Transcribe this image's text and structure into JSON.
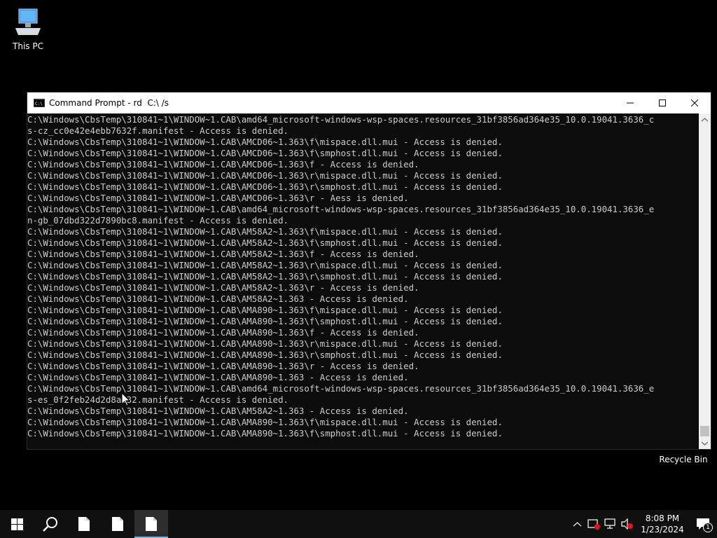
{
  "desktop": {
    "this_pc_label": "This PC",
    "recycle_bin_label": "Recycle Bin"
  },
  "window": {
    "title": "Command Prompt - rd  C:\\ /s"
  },
  "console": {
    "lines": [
      "C:\\Windows\\CbsTemp\\310841~1\\WINDOW~1.CAB\\amd64_microsoft-windows-wsp-spaces.resources_31bf3856ad364e35_10.0.19041.3636_c",
      "s-cz_cc0e42e4ebb7632f.manifest - Access is denied.",
      "C:\\Windows\\CbsTemp\\310841~1\\WINDOW~1.CAB\\AMCD06~1.363\\f\\mispace.dll.mui - Access is denied.",
      "C:\\Windows\\CbsTemp\\310841~1\\WINDOW~1.CAB\\AMCD06~1.363\\f\\smphost.dll.mui - Access is denied.",
      "C:\\Windows\\CbsTemp\\310841~1\\WINDOW~1.CAB\\AMCD06~1.363\\f - Access is denied.",
      "C:\\Windows\\CbsTemp\\310841~1\\WINDOW~1.CAB\\AMCD06~1.363\\r\\mispace.dll.mui - Access is denied.",
      "C:\\Windows\\CbsTemp\\310841~1\\WINDOW~1.CAB\\AMCD06~1.363\\r\\smphost.dll.mui - Access is denied.",
      "C:\\Windows\\CbsTemp\\310841~1\\WINDOW~1.CAB\\AMCD06~1.363\\r - Aess is denied.",
      "C:\\Windows\\CbsTemp\\310841~1\\WINDOW~1.CAB\\amd64_microsoft-windows-wsp-spaces.resources_31bf3856ad364e35_10.0.19041.3636_e",
      "n-gb_07dbd322d7890bc8.manifest - Access is denied.",
      "C:\\Windows\\CbsTemp\\310841~1\\WINDOW~1.CAB\\AM58A2~1.363\\f\\mispace.dll.mui - Access is denied.",
      "C:\\Windows\\CbsTemp\\310841~1\\WINDOW~1.CAB\\AM58A2~1.363\\f\\smphost.dll.mui - Access is denied.",
      "C:\\Windows\\CbsTemp\\310841~1\\WINDOW~1.CAB\\AM58A2~1.363\\f - Access is denied.",
      "C:\\Windows\\CbsTemp\\310841~1\\WINDOW~1.CAB\\AM58A2~1.363\\r\\mispace.dll.mui - Access is denied.",
      "C:\\Windows\\CbsTemp\\310841~1\\WINDOW~1.CAB\\AM58A2~1.363\\r\\smphost.dll.mui - Access is denied.",
      "C:\\Windows\\CbsTemp\\310841~1\\WINDOW~1.CAB\\AM58A2~1.363\\r - Access is denied.",
      "C:\\Windows\\CbsTemp\\310841~1\\WINDOW~1.CAB\\AM58A2~1.363 - Access is denied.",
      "C:\\Windows\\CbsTemp\\310841~1\\WINDOW~1.CAB\\AMA890~1.363\\f\\mispace.dll.mui - Access is denied.",
      "C:\\Windows\\CbsTemp\\310841~1\\WINDOW~1.CAB\\AMA890~1.363\\f\\smphost.dll.mui - Access is denied.",
      "C:\\Windows\\CbsTemp\\310841~1\\WINDOW~1.CAB\\AMA890~1.363\\f - Access is denied.",
      "C:\\Windows\\CbsTemp\\310841~1\\WINDOW~1.CAB\\AMA890~1.363\\r\\mispace.dll.mui - Access is denied.",
      "C:\\Windows\\CbsTemp\\310841~1\\WINDOW~1.CAB\\AMA890~1.363\\r\\smphost.dll.mui - Access is denied.",
      "C:\\Windows\\CbsTemp\\310841~1\\WINDOW~1.CAB\\AMA890~1.363\\r - Access is denied.",
      "C:\\Windows\\CbsTemp\\310841~1\\WINDOW~1.CAB\\AMA890~1.363 - Access is denied.",
      "C:\\Windows\\CbsTemp\\310841~1\\WINDOW~1.CAB\\amd64_microsoft-windows-wsp-spaces.resources_31bf3856ad364e35_10.0.19041.3636_e",
      "s-es_0f2feb24d2d8a132.manifest - Access is denied.",
      "C:\\Windows\\CbsTemp\\310841~1\\WINDOW~1.CAB\\AM58A2~1.363 - Access is denied.",
      "C:\\Windows\\CbsTemp\\310841~1\\WINDOW~1.CAB\\AMA890~1.363\\f\\mispace.dll.mui - Access is denied.",
      "C:\\Windows\\CbsTemp\\310841~1\\WINDOW~1.CAB\\AMA890~1.363\\f\\smphost.dll.mui - Access is denied."
    ]
  },
  "taskbar": {
    "time": "8:08 PM",
    "date": "1/23/2024",
    "notification_count": "1"
  },
  "icons": {
    "start": "windows-logo-icon",
    "search": "search-icon",
    "file1": "document-icon",
    "file2": "document-icon",
    "file3": "document-icon"
  }
}
